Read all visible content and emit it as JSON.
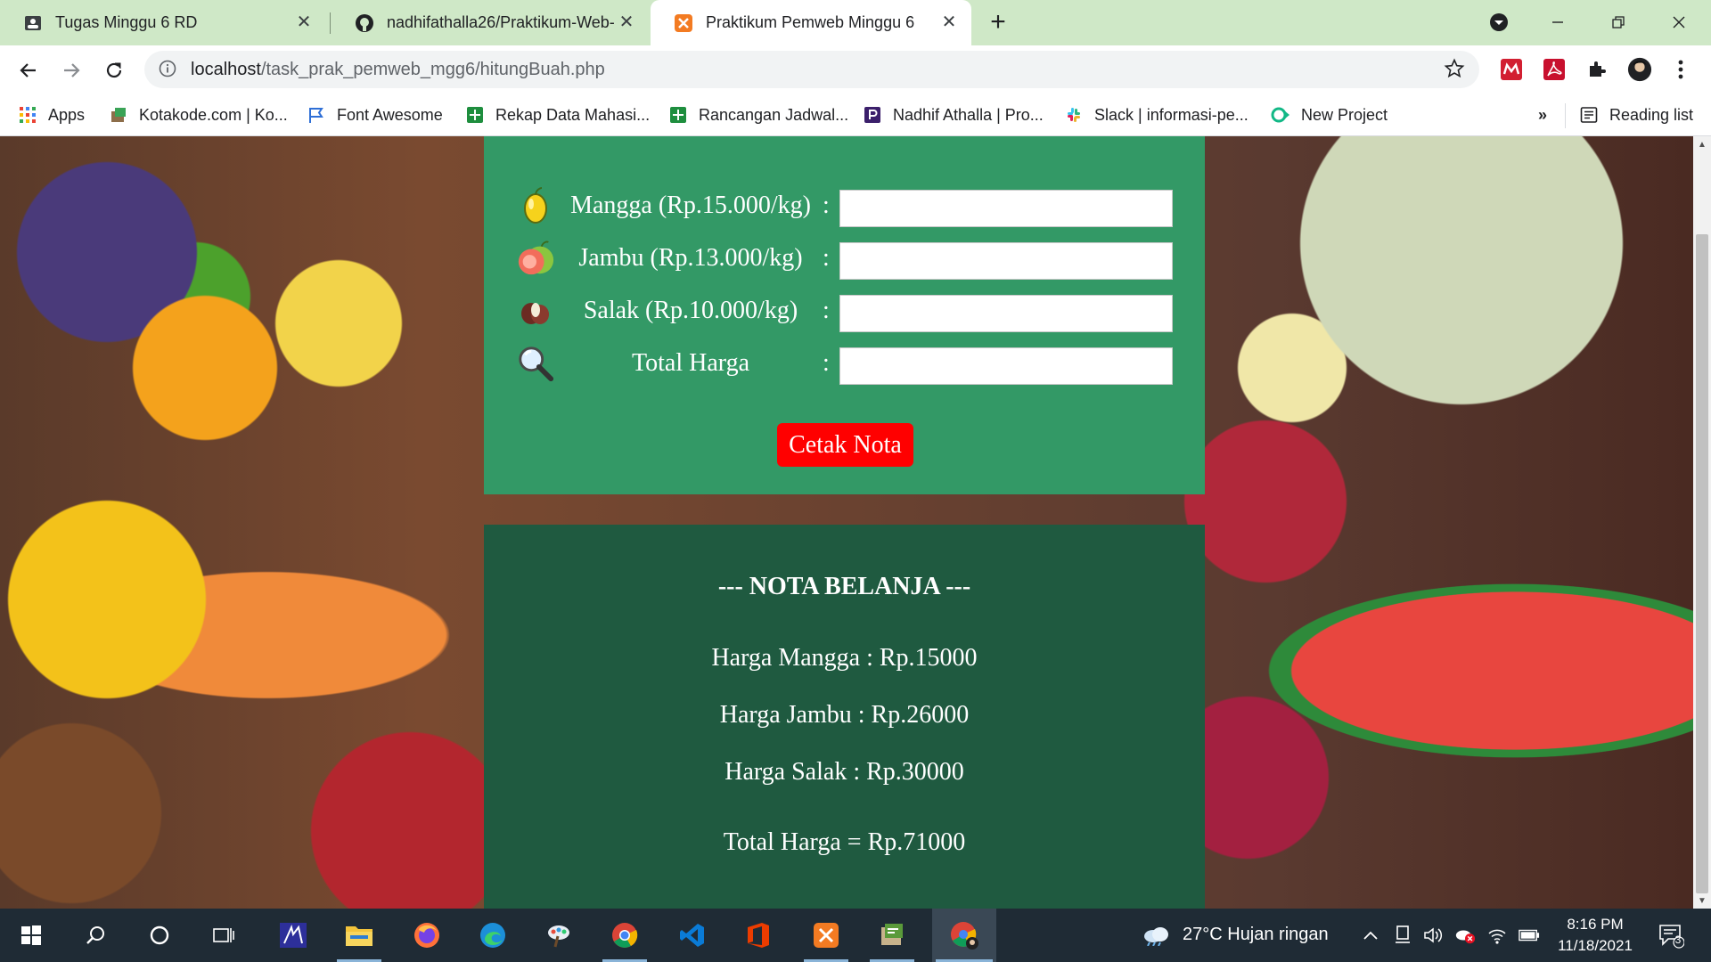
{
  "browser": {
    "tabs": [
      {
        "title": "Tugas Minggu 6 RD",
        "icon": "document-icon",
        "active": false
      },
      {
        "title": "nadhifathalla26/Praktikum-Web-",
        "icon": "github-icon",
        "active": false
      },
      {
        "title": "Praktikum Pemweb Minggu 6",
        "icon": "xampp-icon",
        "active": true
      }
    ],
    "address": {
      "host": "localhost",
      "path": "/task_prak_pemweb_mgg6/hitungBuah.php"
    },
    "bookmarks": [
      {
        "label": "Apps",
        "icon": "apps-grid-icon"
      },
      {
        "label": "Kotakode.com | Ko...",
        "icon": "kotakode-icon"
      },
      {
        "label": "Font Awesome",
        "icon": "flag-icon"
      },
      {
        "label": "Rekap Data Mahasi...",
        "icon": "sheets-icon"
      },
      {
        "label": "Rancangan Jadwal...",
        "icon": "sheets-icon"
      },
      {
        "label": "Nadhif Athalla | Pro...",
        "icon": "portfolio-icon"
      },
      {
        "label": "Slack | informasi-pe...",
        "icon": "slack-icon"
      },
      {
        "label": "New Project",
        "icon": "project-icon"
      }
    ],
    "bookmarks_overflow": "»",
    "reading_list": "Reading list"
  },
  "form": {
    "fields": [
      {
        "label": "Mangga (Rp.15.000/kg)",
        "colon": ":",
        "value": "",
        "icon": "mango-icon"
      },
      {
        "label": "Jambu (Rp.13.000/kg)",
        "colon": ":",
        "value": "",
        "icon": "guava-icon"
      },
      {
        "label": "Salak (Rp.10.000/kg)",
        "colon": ":",
        "value": "",
        "icon": "salak-icon"
      },
      {
        "label": "Total Harga",
        "colon": ":",
        "value": "",
        "icon": "magnifier-icon"
      }
    ],
    "button": "Cetak Nota"
  },
  "nota": {
    "title": "--- NOTA BELANJA ---",
    "lines": [
      "Harga Mangga : Rp.15000",
      "Harga Jambu : Rp.26000",
      "Harga Salak : Rp.30000"
    ],
    "total": "Total Harga = Rp.71000"
  },
  "taskbar": {
    "weather": "27°C  Hujan ringan",
    "time": "8:16 PM",
    "date": "11/18/2021",
    "notifications": "3"
  },
  "colors": {
    "form_panel": "#339966",
    "nota_panel": "#1f5a40",
    "button": "#ff0000",
    "tab_strip": "#cfe8c7"
  }
}
